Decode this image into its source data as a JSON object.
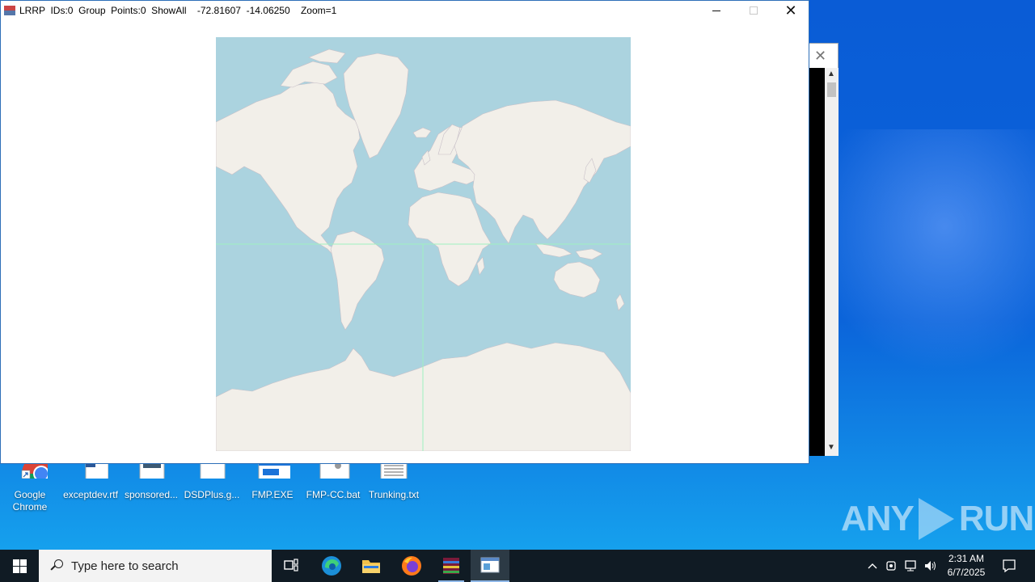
{
  "window": {
    "title": "LRRP  IDs:0  Group  Points:0  ShowAll    -72.81607  -14.06250    Zoom=1",
    "minimize_label": "minimize",
    "maximize_label": "maximize",
    "close_label": "✕"
  },
  "map": {
    "land_color": "#f2efe9",
    "water_color": "#abd3df",
    "crosshair_color": "#9ff0c0"
  },
  "desktop_icons": [
    {
      "label": "Google\nChrome",
      "icon": "chrome-icon"
    },
    {
      "label": "exceptdev.rtf",
      "icon": "wordpad-doc-icon"
    },
    {
      "label": "sponsored...",
      "icon": "image-doc-icon"
    },
    {
      "label": "DSDPlus.g...",
      "icon": "blank-doc-icon"
    },
    {
      "label": "FMP.EXE",
      "icon": "exe-icon"
    },
    {
      "label": "FMP-CC.bat",
      "icon": "batch-file-icon"
    },
    {
      "label": "Trunking.txt",
      "icon": "text-file-icon"
    }
  ],
  "taskbar": {
    "search_placeholder": "Type here to search",
    "apps": [
      "task-view-icon",
      "edge-icon",
      "file-explorer-icon",
      "firefox-icon",
      "winrar-icon",
      "app-window-icon"
    ],
    "time": "2:31 AM",
    "date": "6/7/2025"
  },
  "watermark": {
    "left": "ANY",
    "right": "RUN"
  },
  "console_window": {
    "close_label": "✕"
  }
}
